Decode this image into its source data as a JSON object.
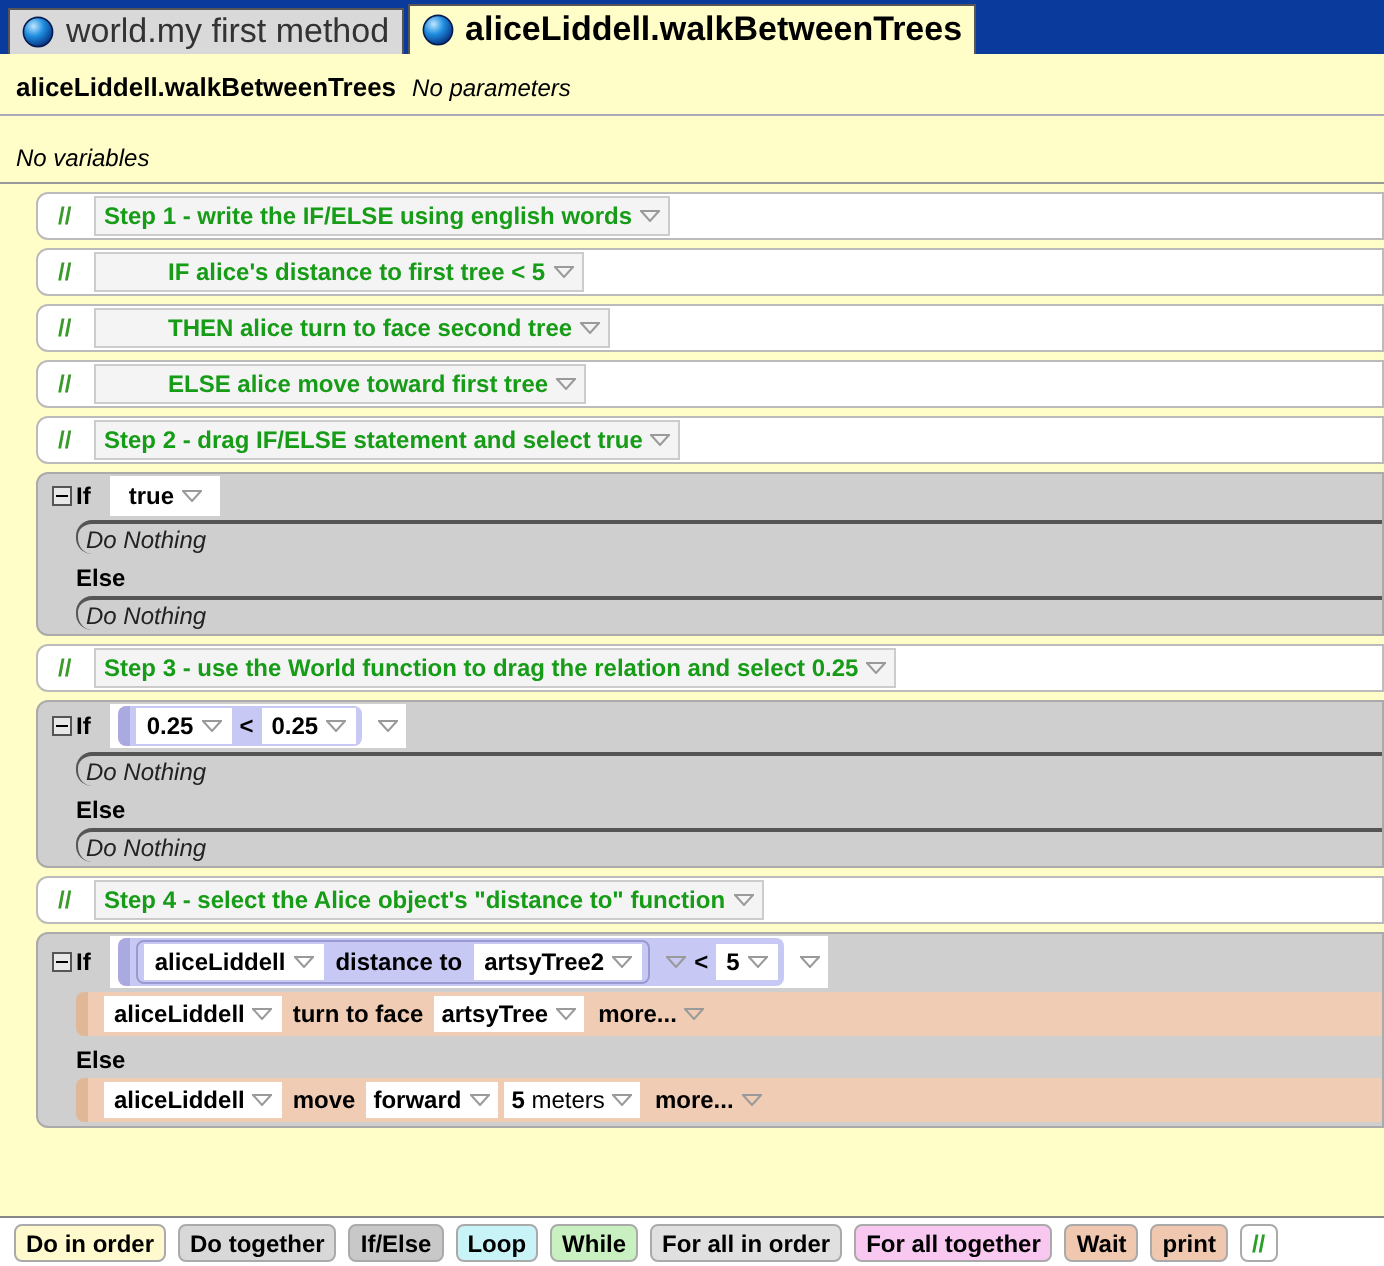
{
  "tabs": [
    {
      "label": "world.my first method",
      "selected": false
    },
    {
      "label": "aliceLiddell.walkBetweenTrees",
      "selected": true
    }
  ],
  "header": {
    "method_name": "aliceLiddell.walkBetweenTrees",
    "parameters": "No parameters",
    "variables": "No variables"
  },
  "statements": [
    {
      "kind": "comment",
      "marker": "//",
      "text": "Step 1 - write the IF/ELSE using english words",
      "indented": false
    },
    {
      "kind": "comment",
      "marker": "//",
      "text": "IF alice's distance to first tree < 5",
      "indented": true
    },
    {
      "kind": "comment",
      "marker": "//",
      "text": "THEN alice turn to face second tree",
      "indented": true
    },
    {
      "kind": "comment",
      "marker": "//",
      "text": "ELSE alice move toward first tree",
      "indented": true
    },
    {
      "kind": "comment",
      "marker": "//",
      "text": "Step 2 - drag IF/ELSE statement and select true",
      "indented": false
    },
    {
      "kind": "if_else",
      "keyword": "If",
      "else_keyword": "Else",
      "condition": {
        "kind": "value",
        "text": "true"
      },
      "then": [
        {
          "kind": "do_nothing",
          "text": "Do Nothing"
        }
      ],
      "else": [
        {
          "kind": "do_nothing",
          "text": "Do Nothing"
        }
      ]
    },
    {
      "kind": "comment",
      "marker": "//",
      "text": "Step 3 - use the World function to drag the relation and select 0.25",
      "indented": false
    },
    {
      "kind": "if_else",
      "keyword": "If",
      "else_keyword": "Else",
      "condition": {
        "kind": "relation",
        "left": {
          "kind": "value",
          "text": "0.25"
        },
        "operator": "<",
        "right": {
          "kind": "value",
          "text": "0.25"
        }
      },
      "then": [
        {
          "kind": "do_nothing",
          "text": "Do Nothing"
        }
      ],
      "else": [
        {
          "kind": "do_nothing",
          "text": "Do Nothing"
        }
      ]
    },
    {
      "kind": "comment",
      "marker": "//",
      "text": "Step 4 - select the Alice object's  \"distance to\" function",
      "indented": false
    },
    {
      "kind": "if_else",
      "keyword": "If",
      "else_keyword": "Else",
      "condition": {
        "kind": "relation",
        "left": {
          "kind": "call",
          "object": "aliceLiddell",
          "function": "distance to",
          "argument": "artsyTree2"
        },
        "operator": "<",
        "right": {
          "kind": "value",
          "text": "5"
        }
      },
      "then": [
        {
          "kind": "method",
          "object": "aliceLiddell",
          "method": "turn to face",
          "arguments": [
            "**artsyTree**"
          ],
          "more": "more..."
        }
      ],
      "else": [
        {
          "kind": "method",
          "object": "aliceLiddell",
          "method": "move",
          "arguments": [
            "**forward**",
            "**5** meters"
          ],
          "more": "more..."
        }
      ]
    }
  ],
  "palette": [
    {
      "label": "Do in order",
      "color": "#fffacd"
    },
    {
      "label": "Do together",
      "color": "#d8d8d8"
    },
    {
      "label": "If/Else",
      "color": "#c8c8c8"
    },
    {
      "label": "Loop",
      "color": "#c8f4f8"
    },
    {
      "label": "While",
      "color": "#c8f0c0"
    },
    {
      "label": "For all in order",
      "color": "#e0e0e0"
    },
    {
      "label": "For all together",
      "color": "#f8c8f0"
    },
    {
      "label": "Wait",
      "color": "#f0c8b0"
    },
    {
      "label": "print",
      "color": "#f0c8b0"
    },
    {
      "label": "//",
      "color": "#ffffff"
    }
  ]
}
